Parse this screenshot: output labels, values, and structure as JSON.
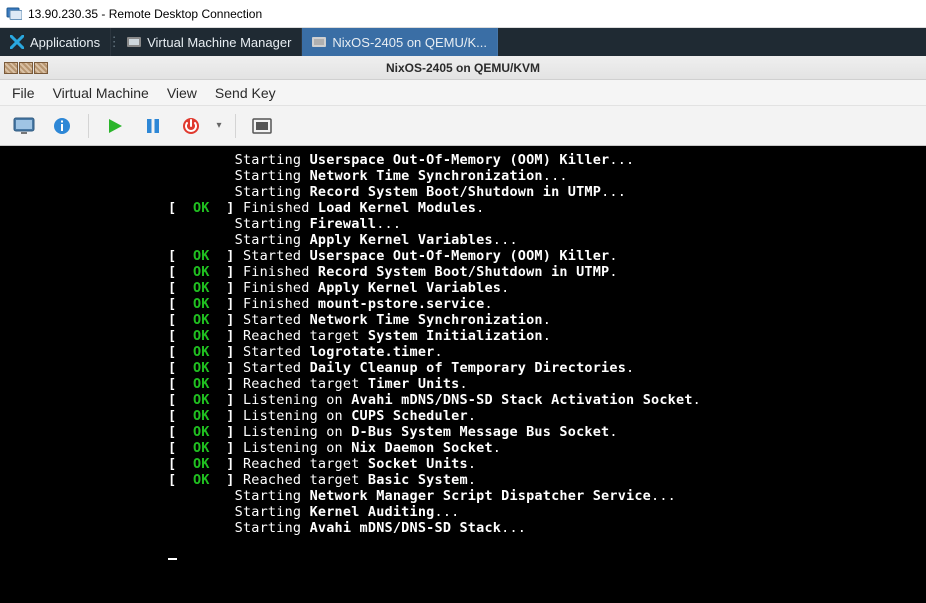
{
  "win_title": "13.90.230.35 - Remote Desktop Connection",
  "taskbar": {
    "applications_label": "Applications",
    "vmm_label": "Virtual Machine Manager",
    "vm_tab_label": "NixOS-2405 on QEMU/K..."
  },
  "vm_titlebar": "NixOS-2405 on QEMU/KVM",
  "menu": {
    "file": "File",
    "vm": "Virtual Machine",
    "view": "View",
    "sendkey": "Send Key"
  },
  "toolbar": {
    "monitor": "monitor-icon",
    "info": "info-icon",
    "play": "play-icon",
    "pause": "pause-icon",
    "power": "power-icon",
    "fullscreen": "fullscreen-icon"
  },
  "boot": [
    {
      "status": "",
      "verb": "Starting",
      "unit": "Userspace Out-Of-Memory (OOM) Killer",
      "trail": "..."
    },
    {
      "status": "",
      "verb": "Starting",
      "unit": "Network Time Synchronization",
      "trail": "..."
    },
    {
      "status": "",
      "verb": "Starting",
      "unit": "Record System Boot/Shutdown in UTMP",
      "trail": "..."
    },
    {
      "status": "OK",
      "verb": "Finished",
      "unit": "Load Kernel Modules",
      "trail": "."
    },
    {
      "status": "",
      "verb": "Starting",
      "unit": "Firewall",
      "trail": "..."
    },
    {
      "status": "",
      "verb": "Starting",
      "unit": "Apply Kernel Variables",
      "trail": "..."
    },
    {
      "status": "OK",
      "verb": "Started",
      "unit": "Userspace Out-Of-Memory (OOM) Killer",
      "trail": "."
    },
    {
      "status": "OK",
      "verb": "Finished",
      "unit": "Record System Boot/Shutdown in UTMP",
      "trail": "."
    },
    {
      "status": "OK",
      "verb": "Finished",
      "unit": "Apply Kernel Variables",
      "trail": "."
    },
    {
      "status": "OK",
      "verb": "Finished",
      "unit": "mount-pstore.service",
      "trail": "."
    },
    {
      "status": "OK",
      "verb": "Started",
      "unit": "Network Time Synchronization",
      "trail": "."
    },
    {
      "status": "OK",
      "verb": "Reached target",
      "unit": "System Initialization",
      "trail": "."
    },
    {
      "status": "OK",
      "verb": "Started",
      "unit": "logrotate.timer",
      "trail": "."
    },
    {
      "status": "OK",
      "verb": "Started",
      "unit": "Daily Cleanup of Temporary Directories",
      "trail": "."
    },
    {
      "status": "OK",
      "verb": "Reached target",
      "unit": "Timer Units",
      "trail": "."
    },
    {
      "status": "OK",
      "verb": "Listening on",
      "unit": "Avahi mDNS/DNS-SD Stack Activation Socket",
      "trail": "."
    },
    {
      "status": "OK",
      "verb": "Listening on",
      "unit": "CUPS Scheduler",
      "trail": "."
    },
    {
      "status": "OK",
      "verb": "Listening on",
      "unit": "D-Bus System Message Bus Socket",
      "trail": "."
    },
    {
      "status": "OK",
      "verb": "Listening on",
      "unit": "Nix Daemon Socket",
      "trail": "."
    },
    {
      "status": "OK",
      "verb": "Reached target",
      "unit": "Socket Units",
      "trail": "."
    },
    {
      "status": "OK",
      "verb": "Reached target",
      "unit": "Basic System",
      "trail": "."
    },
    {
      "status": "",
      "verb": "Starting",
      "unit": "Network Manager Script Dispatcher Service",
      "trail": "..."
    },
    {
      "status": "",
      "verb": "Starting",
      "unit": "Kernel Auditing",
      "trail": "..."
    },
    {
      "status": "",
      "verb": "Starting",
      "unit": "Avahi mDNS/DNS-SD Stack",
      "trail": "..."
    }
  ]
}
